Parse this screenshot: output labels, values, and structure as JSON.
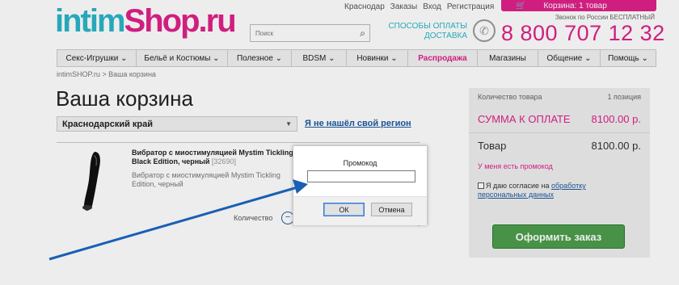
{
  "header": {
    "logo_part1": "intim",
    "logo_part2": "Shop.ru",
    "top_links": [
      "Краснодар",
      "Заказы",
      "Вход",
      "Регистрация"
    ],
    "cart_label": "Корзина: 1 товар",
    "search_placeholder": "Поиск",
    "pay_line1": "СПОСОБЫ ОПЛАТЫ",
    "pay_line2": "ДОСТАВКА",
    "phone_note": "Звонок по России БЕСПЛАТНЫЙ",
    "phone": "8 800 707 12 32"
  },
  "nav": [
    "Секс-Игрушки",
    "Бельё и Костюмы",
    "Полезное",
    "BDSM",
    "Новинки",
    "Распродажа",
    "Магазины",
    "Общение",
    "Помощь"
  ],
  "breadcrumb": "intimSHOP.ru > Ваша корзина",
  "main": {
    "title": "Ваша корзина",
    "region_value": "Краснодарский край",
    "region_link": "Я не нашёл свой регион",
    "product": {
      "name": "Вибратор с миостимуляцией Mystim Tickling Black Edition, черный",
      "code": "[32690]",
      "desc": "Вибратор с миостимуляцией Mystim Tickling Edition, черный",
      "qty_label": "Количество",
      "qty_minus": "−"
    }
  },
  "sidebar": {
    "count_label": "Количество товара",
    "count_value": "1 позиция",
    "sum_label": "СУММА К ОПЛАТЕ",
    "sum_value": "8100.00 р.",
    "goods_label": "Товар",
    "goods_value": "8100.00 р.",
    "promo_link": "У меня есть промокод",
    "consent_prefix": "Я даю согласие на",
    "consent_link": "обработку персональных данных",
    "order_button": "Оформить заказ"
  },
  "dialog": {
    "title": "Промокод",
    "input_value": "",
    "ok": "ОК",
    "cancel": "Отмена"
  },
  "colors": {
    "brand_pink": "#e0218a",
    "brand_teal": "#2bb5c9",
    "link_blue": "#1c5a9f",
    "order_green": "#4d9e4d",
    "annotation_arrow": "#1a5fb4"
  }
}
